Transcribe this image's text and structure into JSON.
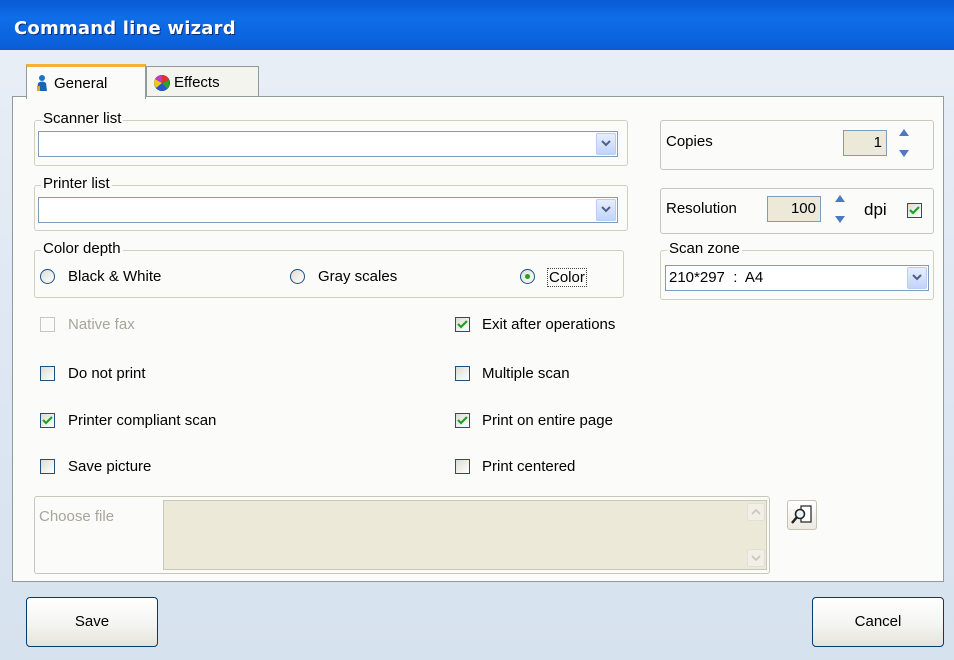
{
  "window": {
    "title": "Command line wizard"
  },
  "tabs": [
    {
      "label": "General",
      "icon": "person-icon",
      "active": true
    },
    {
      "label": "Effects",
      "icon": "color-wheel-icon",
      "active": false
    }
  ],
  "scanner": {
    "label": "Scanner list",
    "value": ""
  },
  "printer": {
    "label": "Printer list",
    "value": ""
  },
  "color_depth": {
    "label": "Color depth",
    "options": [
      {
        "label": "Black & White",
        "selected": false
      },
      {
        "label": "Gray scales",
        "selected": false
      },
      {
        "label": "Color",
        "selected": true
      }
    ]
  },
  "copies": {
    "label": "Copies",
    "value": "1"
  },
  "resolution": {
    "label": "Resolution",
    "value": "100",
    "unit": "dpi",
    "checked": true
  },
  "scan_zone": {
    "label": "Scan zone",
    "value": "210*297  :  A4"
  },
  "checkboxes": {
    "native_fax": {
      "label": "Native fax",
      "checked": false,
      "disabled": true
    },
    "exit_after": {
      "label": "Exit after operations",
      "checked": true
    },
    "do_not_print": {
      "label": "Do not print",
      "checked": false
    },
    "multiple_scan": {
      "label": "Multiple scan",
      "checked": false
    },
    "printer_compliant": {
      "label": "Printer compliant scan",
      "checked": true
    },
    "print_entire": {
      "label": "Print on entire page",
      "checked": true
    },
    "save_picture": {
      "label": "Save picture",
      "checked": false
    },
    "print_centered": {
      "label": "Print centered",
      "checked": false
    }
  },
  "choose_file": {
    "label": "Choose file",
    "value": ""
  },
  "buttons": {
    "save": "Save",
    "cancel": "Cancel"
  },
  "colors": {
    "title_bar": "#0b62dc",
    "check_green": "#21a121",
    "tab_accent": "#f2b233"
  }
}
